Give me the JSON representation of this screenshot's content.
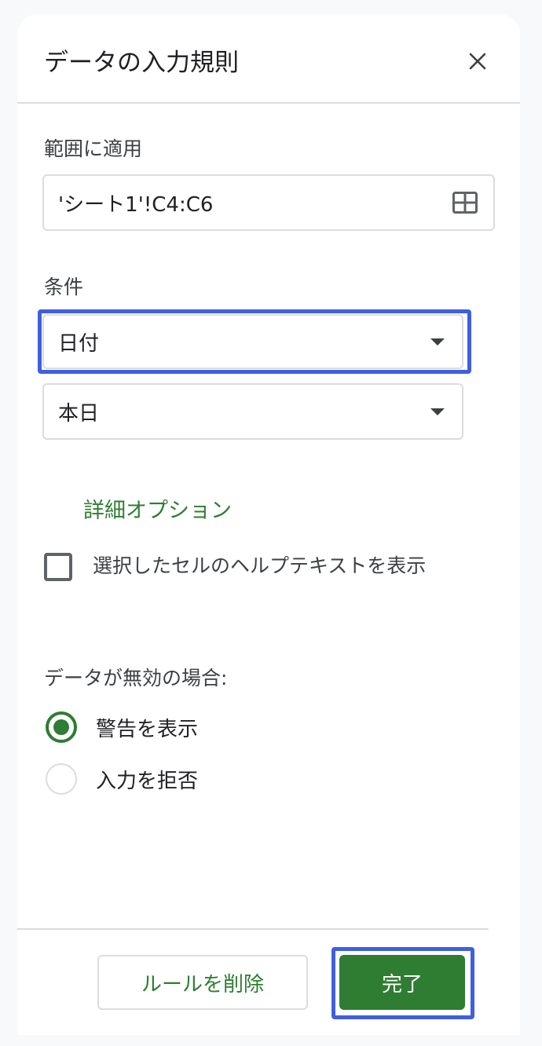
{
  "dialog": {
    "title": "データの入力規則",
    "close_icon": "close-icon"
  },
  "range": {
    "label": "範囲に適用",
    "value": "'シート1'!C4:C6",
    "icon": "grid-select-icon"
  },
  "criteria": {
    "label": "条件",
    "type_selected": "日付",
    "condition_selected": "本日"
  },
  "advanced_link": "詳細オプション",
  "help_text_checkbox": {
    "label": "選択したセルのヘルプテキストを表示",
    "checked": false
  },
  "invalid_data": {
    "label": "データが無効の場合:",
    "options": [
      {
        "label": "警告を表示",
        "selected": true
      },
      {
        "label": "入力を拒否",
        "selected": false
      }
    ]
  },
  "footer": {
    "delete_label": "ルールを削除",
    "done_label": "完了"
  },
  "colors": {
    "accent": "#2e7d32",
    "focus": "#3f5fe0"
  }
}
